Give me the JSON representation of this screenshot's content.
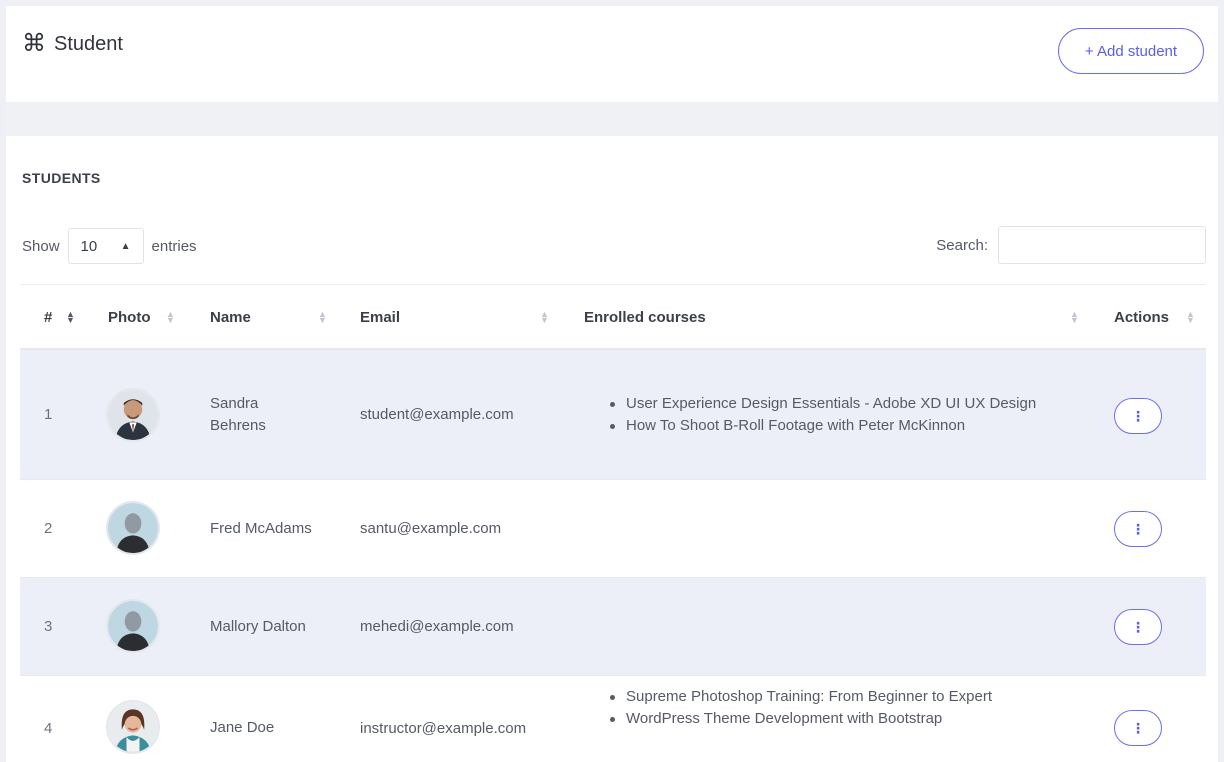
{
  "header": {
    "title": "Student",
    "title_icon": "command-icon",
    "add_button_label": "+ Add student"
  },
  "section": {
    "heading": "STUDENTS"
  },
  "controls": {
    "show_label": "Show",
    "entries_value": "10",
    "entries_label": "entries",
    "search_label": "Search:",
    "search_value": ""
  },
  "table": {
    "columns": [
      "#",
      "Photo",
      "Name",
      "Email",
      "Enrolled courses",
      "Actions"
    ],
    "rows": [
      {
        "num": "1",
        "name": "Sandra Behrens",
        "email": "student@example.com",
        "courses": [
          "User Experience Design Essentials - Adobe XD UI UX Design",
          "How To Shoot B-Roll Footage with Peter McKinnon"
        ],
        "avatar": "man-suit-photo",
        "action_icon": "more-vertical-icon"
      },
      {
        "num": "2",
        "name": "Fred McAdams",
        "email": "santu@example.com",
        "courses": [],
        "avatar": "default-avatar",
        "action_icon": "more-vertical-icon"
      },
      {
        "num": "3",
        "name": "Mallory Dalton",
        "email": "mehedi@example.com",
        "courses": [],
        "avatar": "default-avatar",
        "action_icon": "more-vertical-icon"
      },
      {
        "num": "4",
        "name": "Jane Doe",
        "email": "instructor@example.com",
        "courses": [
          "Supreme Photoshop Training: From Beginner to Expert",
          "WordPress Theme Development with Bootstrap"
        ],
        "avatar": "woman-photo",
        "action_icon": "more-vertical-icon"
      }
    ]
  },
  "colors": {
    "accent": "#5b5de6",
    "row_shade": "#eceff7",
    "page_bg": "#eef0f5"
  }
}
